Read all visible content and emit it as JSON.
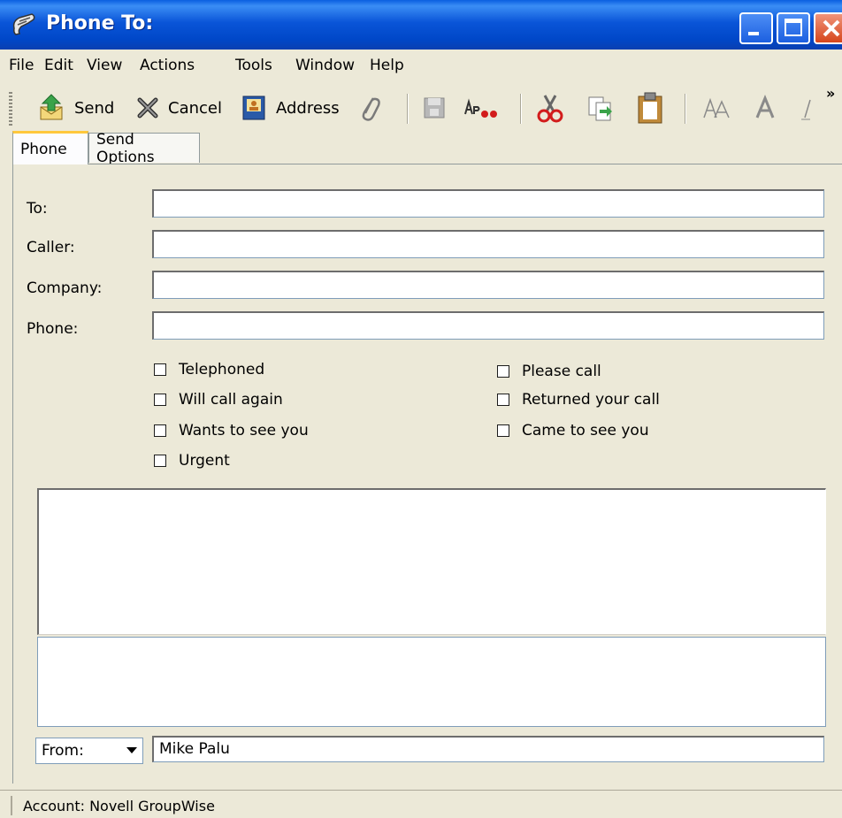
{
  "window": {
    "title": "Phone To:"
  },
  "menu": [
    "File",
    "Edit",
    "View",
    "Actions",
    "Tools",
    "Window",
    "Help"
  ],
  "toolbar": {
    "send_label": "Send",
    "cancel_label": "Cancel",
    "address_label": "Address",
    "overflow": "»"
  },
  "tabs": [
    "Phone",
    "Send Options"
  ],
  "form": {
    "to_label": "To:",
    "caller_label": "Caller:",
    "company_label": "Company:",
    "phone_label": "Phone:",
    "to_value": "",
    "caller_value": "",
    "company_value": "",
    "phone_value": ""
  },
  "checkboxes": {
    "telephoned": "Telephoned",
    "will_call_again": "Will call again",
    "wants_to_see_you": "Wants to see you",
    "urgent": "Urgent",
    "please_call": "Please call",
    "returned_your_call": "Returned your call",
    "came_to_see_you": "Came to see you"
  },
  "from": {
    "label": "From:",
    "value": "Mike Palu"
  },
  "status": {
    "account": "Account: Novell GroupWise"
  },
  "colors": {
    "titlebar": "#0a55d8",
    "window_bg": "#ece9d8",
    "tab_accent": "#ffc83c"
  }
}
